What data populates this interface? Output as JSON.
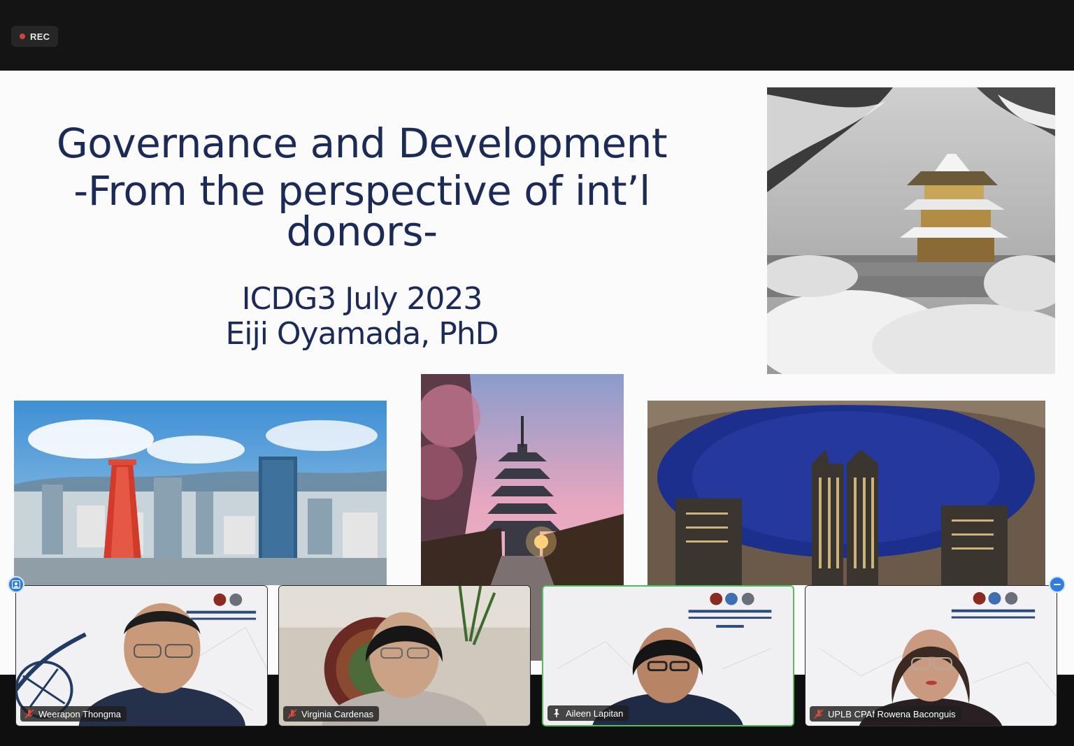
{
  "recording": {
    "label": "REC",
    "status_color": "#d0453a"
  },
  "slide": {
    "title_line1": "Governance and Development",
    "title_line2": "-From the perspective of int’l donors-",
    "event": "ICDG3 July 2023",
    "presenter": "Eiji Oyamada, PhD",
    "text_color": "#1c2a57",
    "photos": [
      "kinkakuji-snow-photo",
      "kobe-port-tower-photo",
      "kyoto-yasaka-pagoda-photo",
      "tokyo-government-building-photo"
    ]
  },
  "participants": [
    {
      "name": "Weerapon Thongma",
      "mic": "muted",
      "active": false
    },
    {
      "name": "Virginia Cardenas",
      "mic": "muted",
      "active": false
    },
    {
      "name": "Aileen Lapitan",
      "mic": "pinned",
      "active": true
    },
    {
      "name": "UPLB CPAf Rowena Baconguis",
      "mic": "muted",
      "active": false
    }
  ],
  "controls": {
    "left_button": "participant-view-icon",
    "right_button": "minimize-icon",
    "accent": "#2f7de1"
  }
}
